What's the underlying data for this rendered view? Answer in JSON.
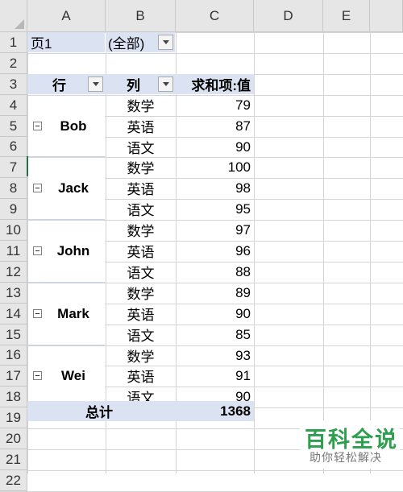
{
  "columns": [
    "A",
    "B",
    "C",
    "D",
    "E"
  ],
  "rows": [
    "1",
    "2",
    "3",
    "4",
    "5",
    "6",
    "7",
    "8",
    "9",
    "10",
    "11",
    "12",
    "13",
    "14",
    "15",
    "16",
    "17",
    "18",
    "19",
    "20",
    "21",
    "22"
  ],
  "page_filter": {
    "label": "页1",
    "value": "(全部)"
  },
  "pivot_headers": {
    "row": "行",
    "col": "列",
    "value": "求和项:值"
  },
  "groups": [
    {
      "name": "Bob",
      "items": [
        {
          "subject": "数学",
          "value": "79"
        },
        {
          "subject": "英语",
          "value": "87"
        },
        {
          "subject": "语文",
          "value": "90"
        }
      ]
    },
    {
      "name": "Jack",
      "items": [
        {
          "subject": "数学",
          "value": "100"
        },
        {
          "subject": "英语",
          "value": "98"
        },
        {
          "subject": "语文",
          "value": "95"
        }
      ]
    },
    {
      "name": "John",
      "items": [
        {
          "subject": "数学",
          "value": "97"
        },
        {
          "subject": "英语",
          "value": "96"
        },
        {
          "subject": "语文",
          "value": "88"
        }
      ]
    },
    {
      "name": "Mark",
      "items": [
        {
          "subject": "数学",
          "value": "89"
        },
        {
          "subject": "英语",
          "value": "90"
        },
        {
          "subject": "语文",
          "value": "85"
        }
      ]
    },
    {
      "name": "Wei",
      "items": [
        {
          "subject": "数学",
          "value": "93"
        },
        {
          "subject": "英语",
          "value": "91"
        },
        {
          "subject": "语文",
          "value": "90"
        }
      ]
    }
  ],
  "total": {
    "label": "总计",
    "value": "1368"
  },
  "watermark": {
    "title": "百科全说",
    "subtitle": "助你轻松解决"
  },
  "colors": {
    "pivot_blue": "#dbe3f3",
    "header_gray": "#e6e6e6",
    "watermark_green": "#2e9e4f"
  }
}
